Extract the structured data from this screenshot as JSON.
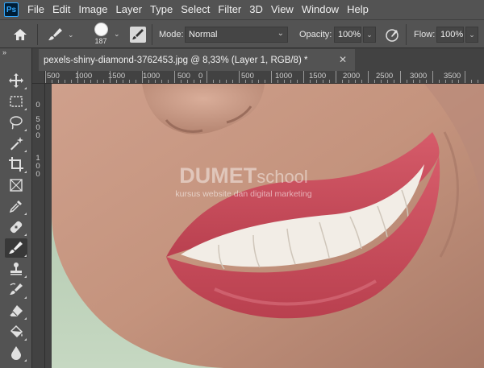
{
  "app": {
    "logo": "Ps"
  },
  "menu": [
    "File",
    "Edit",
    "Image",
    "Layer",
    "Type",
    "Select",
    "Filter",
    "3D",
    "View",
    "Window",
    "Help"
  ],
  "options": {
    "brush_size": "187",
    "mode_label": "Mode:",
    "mode_value": "Normal",
    "opacity_label": "Opacity:",
    "opacity_value": "100%",
    "flow_label": "Flow:",
    "flow_value": "100%"
  },
  "document_tab": {
    "title": "pexels-shiny-diamond-3762453.jpg @ 8,33% (Layer 1, RGB/8) *",
    "close_icon": "close-icon"
  },
  "ruler": {
    "horizontal_labels": [
      "500",
      "1000",
      "1500",
      "1000",
      "500",
      "0",
      "500",
      "1000",
      "1500",
      "2000",
      "2500",
      "3000",
      "3500"
    ],
    "vertical_labels": [
      "0",
      "5",
      "0",
      "0",
      "1",
      "0",
      "0"
    ]
  },
  "toolbar": {
    "collapse_label": "»",
    "tools": [
      "move-icon",
      "marquee-icon",
      "lasso-icon",
      "magic-wand-icon",
      "crop-icon",
      "frame-icon",
      "eyedropper-icon",
      "healing-brush-icon",
      "brush-icon",
      "clone-stamp-icon",
      "history-brush-icon",
      "eraser-icon",
      "paint-bucket-icon",
      "blur-icon"
    ]
  },
  "watermark": {
    "title_bold": "DUMET",
    "title_light": "school",
    "subtitle": "kursus website dan digital marketing"
  },
  "colors": {
    "ps_accent": "#31a8ff",
    "panel_bg": "#535353",
    "lip_color": "#c9505f"
  }
}
